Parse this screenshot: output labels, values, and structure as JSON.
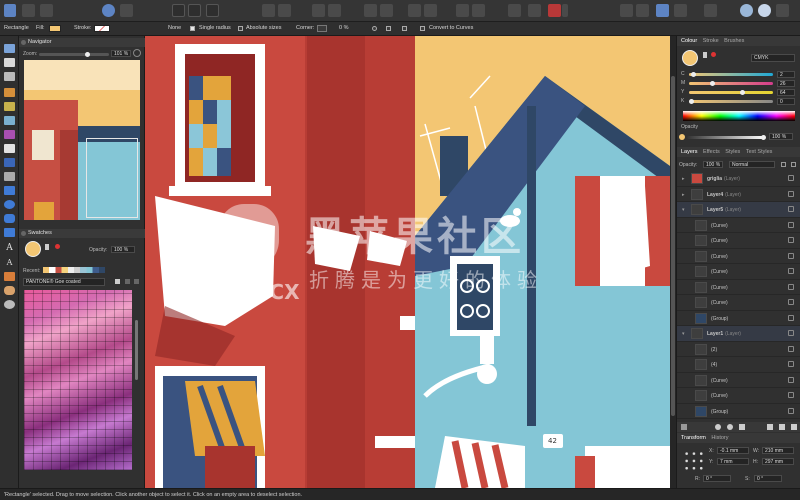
{
  "context_bar": {
    "tool_name": "Rectangle",
    "fill_label": "Fill:",
    "stroke_label": "Stroke:",
    "stroke_value": "None",
    "single_radius": "Single radius",
    "absolute_sizes": "Absolute sizes",
    "corner_label": "Corner:",
    "corner_value": "0 %",
    "convert_label": "Convert to Curves",
    "fill_color": "#f3c673"
  },
  "navigator": {
    "title": "Navigator",
    "zoom_label": "Zoom:",
    "zoom_value": "101 %"
  },
  "swatches": {
    "title": "Swatches",
    "opacity_label": "Opacity:",
    "opacity_value": "100 %",
    "recent_label": "Recent:",
    "palette_name": "PANTONE® Goe coated"
  },
  "colour_panel": {
    "tabs": [
      "Colour",
      "Stroke",
      "Brushes"
    ],
    "model": "CMYK",
    "channels": [
      {
        "label": "C",
        "value": "2",
        "color": "#1fa9d6",
        "level": 0.02
      },
      {
        "label": "M",
        "value": "26",
        "color": "#d43c8c",
        "level": 0.26
      },
      {
        "label": "Y",
        "value": "64",
        "color": "#e4d530",
        "level": 0.64
      },
      {
        "label": "K",
        "value": "0",
        "color": "#888888",
        "level": 0.0
      }
    ],
    "opacity_label": "Opacity",
    "opacity_value": "100 %"
  },
  "layers_panel": {
    "tabs": [
      "Layers",
      "Effects",
      "Styles",
      "Text Styles"
    ],
    "opacity_label": "Opacity:",
    "opacity_value": "100 %",
    "blend_mode": "Normal",
    "rows": [
      {
        "name": "griglia",
        "suffix": "(Layer)",
        "indent": 0,
        "expanded": false
      },
      {
        "name": "Layer4",
        "suffix": "(Layer)",
        "indent": 0,
        "expanded": false
      },
      {
        "name": "Layer5",
        "suffix": "(Layer)",
        "indent": 0,
        "expanded": true
      },
      {
        "name": "(Curve)",
        "suffix": "",
        "indent": 1,
        "expanded": false
      },
      {
        "name": "(Curve)",
        "suffix": "",
        "indent": 1,
        "expanded": false
      },
      {
        "name": "(Curve)",
        "suffix": "",
        "indent": 1,
        "expanded": false
      },
      {
        "name": "(Curve)",
        "suffix": "",
        "indent": 1,
        "expanded": false
      },
      {
        "name": "(Curve)",
        "suffix": "",
        "indent": 1,
        "expanded": false
      },
      {
        "name": "(Curve)",
        "suffix": "",
        "indent": 1,
        "expanded": false
      },
      {
        "name": "(Group)",
        "suffix": "",
        "indent": 1,
        "expanded": false
      },
      {
        "name": "Layer1",
        "suffix": "(Layer)",
        "indent": 0,
        "expanded": true
      },
      {
        "name": "(2)",
        "suffix": "",
        "indent": 1,
        "expanded": false
      },
      {
        "name": "(4)",
        "suffix": "",
        "indent": 1,
        "expanded": false
      },
      {
        "name": "(Curve)",
        "suffix": "",
        "indent": 1,
        "expanded": false
      },
      {
        "name": "(Curve)",
        "suffix": "",
        "indent": 1,
        "expanded": false
      },
      {
        "name": "(Group)",
        "suffix": "",
        "indent": 1,
        "expanded": false
      }
    ]
  },
  "transform_panel": {
    "tabs": [
      "Transform",
      "History"
    ],
    "x_label": "X:",
    "x_value": "-0.1 mm",
    "y_label": "Y:",
    "y_value": "7 mm",
    "w_label": "W:",
    "w_value": "210 mm",
    "h_label": "H:",
    "h_value": "297 mm",
    "r_label": "R:",
    "r_value": "0 °",
    "s_label": "S:",
    "s_value": "0 °"
  },
  "status_bar": {
    "text": "'Rectangle' selected. Drag to move selection. Click another object to select it. Click on an empty area to deselect selection."
  },
  "watermark": {
    "main": "黑苹果社区",
    "domain": "OSX.CX",
    "slogan": "折腾是为更好的体验"
  },
  "canvas_art": {
    "house_number": "42"
  }
}
